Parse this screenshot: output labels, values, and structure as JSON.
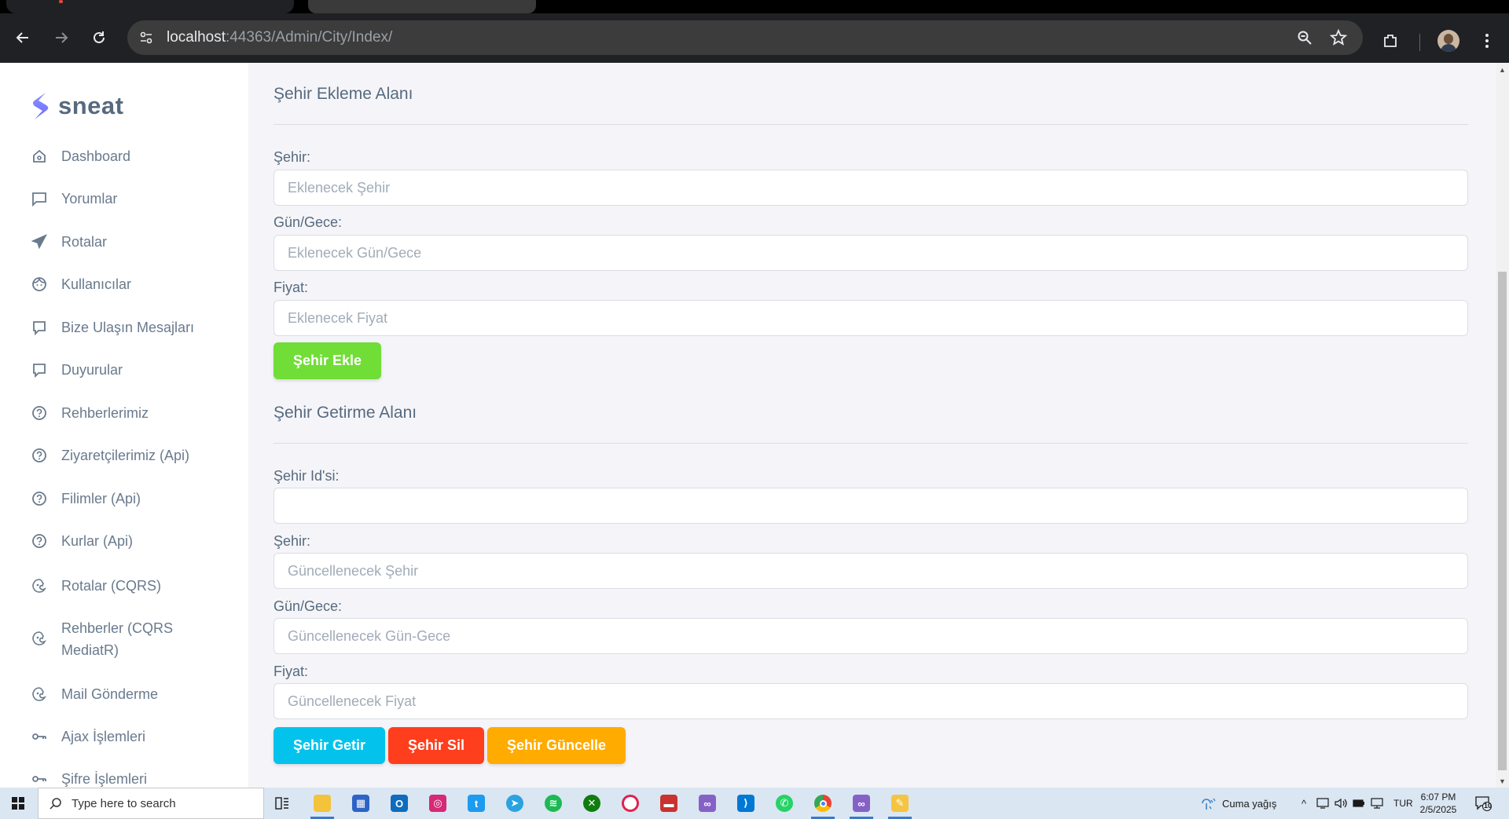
{
  "browser": {
    "url_host": "localhost",
    "url_path": ":44363/Admin/City/Index/"
  },
  "sidebar": {
    "brand": "sneat",
    "items": [
      {
        "label": "Dashboard",
        "icon": "home-icon"
      },
      {
        "label": "Yorumlar",
        "icon": "comment-icon"
      },
      {
        "label": "Rotalar",
        "icon": "plane-icon"
      },
      {
        "label": "Kullanıcılar",
        "icon": "face-icon"
      },
      {
        "label": "Bize Ulaşın Mesajları",
        "icon": "message-icon"
      },
      {
        "label": "Duyurular",
        "icon": "message-icon"
      },
      {
        "label": "Rehberlerimiz",
        "icon": "help-icon"
      },
      {
        "label": "Ziyaretçilerimiz (Api)",
        "icon": "help-icon"
      },
      {
        "label": "Filimler (Api)",
        "icon": "help-icon"
      },
      {
        "label": "Kurlar (Api)",
        "icon": "help-icon"
      },
      {
        "label": "Rotalar (CQRS)",
        "icon": "mailchimp-icon"
      },
      {
        "label": "Rehberler (CQRS MediatR)",
        "icon": "mailchimp-icon"
      },
      {
        "label": "Mail Gönderme",
        "icon": "mailchimp-icon"
      },
      {
        "label": "Ajax İşlemleri",
        "icon": "key-icon"
      },
      {
        "label": "Şifre İşlemleri",
        "icon": "key-icon"
      }
    ]
  },
  "add_section": {
    "title": "Şehir Ekleme Alanı",
    "city_label": "Şehir:",
    "city_placeholder": "Eklenecek Şehir",
    "daynight_label": "Gün/Gece:",
    "daynight_placeholder": "Eklenecek Gün/Gece",
    "price_label": "Fiyat:",
    "price_placeholder": "Eklenecek Fiyat",
    "add_button": "Şehir Ekle"
  },
  "get_section": {
    "title": "Şehir Getirme Alanı",
    "id_label": "Şehir Id'si:",
    "id_value": "",
    "city_label": "Şehir:",
    "city_placeholder": "Güncellenecek Şehir",
    "daynight_label": "Gün/Gece:",
    "daynight_placeholder": "Güncellenecek Gün-Gece",
    "price_label": "Fiyat:",
    "price_placeholder": "Güncellenecek Fiyat",
    "get_button": "Şehir Getir",
    "delete_button": "Şehir Sil",
    "update_button": "Şehir Güncelle"
  },
  "taskbar": {
    "search_placeholder": "Type here to search",
    "weather": "Cuma yağış",
    "language": "TUR",
    "time": "6:07 PM",
    "date": "2/5/2025",
    "notification_count": "10"
  },
  "colors": {
    "primary": "#696cff",
    "success": "#71dd37",
    "info": "#03c3ec",
    "danger": "#ff3e1d",
    "warning": "#ffab00"
  }
}
